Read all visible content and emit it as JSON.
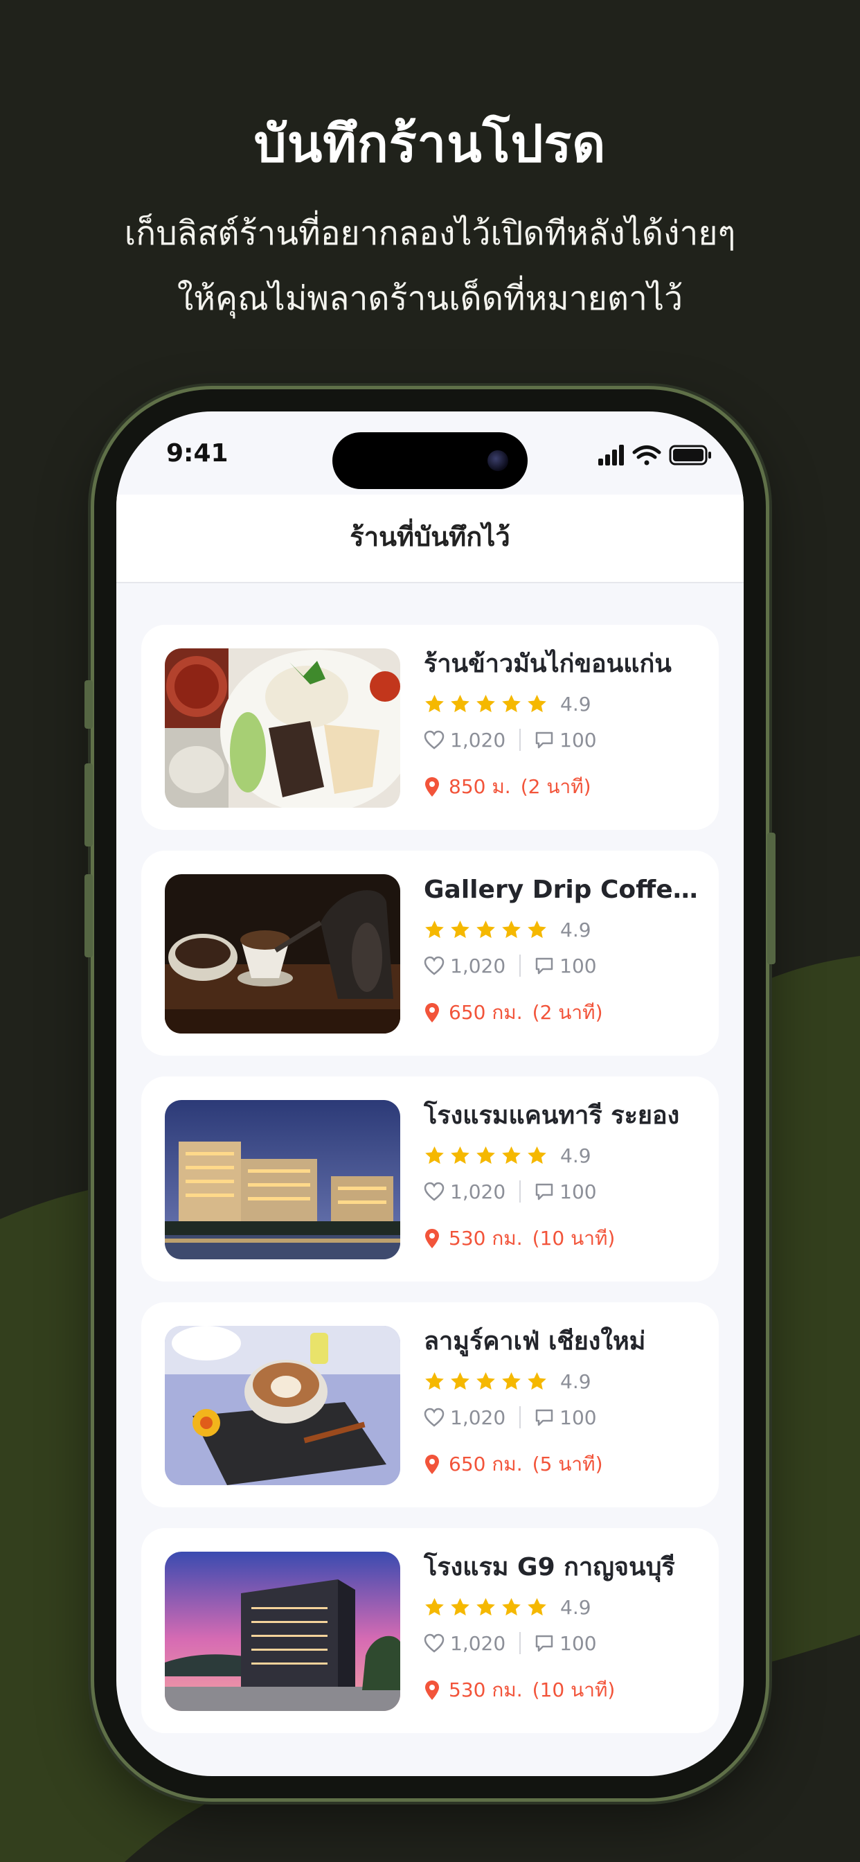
{
  "hero": {
    "title": "บันทึกร้านโปรด",
    "subtitle_line1": "เก็บลิสต์ร้านที่อยากลองไว้เปิดทีหลังได้ง่ายๆ",
    "subtitle_line2": "ให้คุณไม่พลาดร้านเด็ดที่หมายตาไว้"
  },
  "status_bar": {
    "time": "9:41",
    "icons": [
      "signal-icon",
      "wifi-icon",
      "battery-icon"
    ]
  },
  "header": {
    "title": "ร้านที่บันทึกไว้"
  },
  "colors": {
    "background": "#20221b",
    "wave": "#333f1d",
    "accent": "#f2543a",
    "star": "#f5b800"
  },
  "places": [
    {
      "name": "ร้านข้าวมันไก่ขอนแก่น",
      "rating": "4.9",
      "stars": 5,
      "likes": "1,020",
      "comments": "100",
      "distance": "850 ม.",
      "time": "(2 นาที)",
      "image": "chicken-rice-photo"
    },
    {
      "name": "Gallery Drip Coffe...",
      "rating": "4.9",
      "stars": 5,
      "likes": "1,020",
      "comments": "100",
      "distance": "650 กม.",
      "time": "(2 นาที)",
      "image": "drip-coffee-photo"
    },
    {
      "name": "โรงแรมแคนทารี ระยอง",
      "rating": "4.9",
      "stars": 5,
      "likes": "1,020",
      "comments": "100",
      "distance": "530 กม.",
      "time": "(10 นาที)",
      "image": "hotel-night-photo"
    },
    {
      "name": "ลามูร์คาเฟ่ เชียงใหม่",
      "rating": "4.9",
      "stars": 5,
      "likes": "1,020",
      "comments": "100",
      "distance": "650 กม.",
      "time": "(5 นาที)",
      "image": "latte-art-photo"
    },
    {
      "name": "โรงแรม G9 กาญจนบุรี",
      "rating": "4.9",
      "stars": 5,
      "likes": "1,020",
      "comments": "100",
      "distance": "530 กม.",
      "time": "(10 นาที)",
      "image": "hotel-sunset-photo"
    }
  ]
}
